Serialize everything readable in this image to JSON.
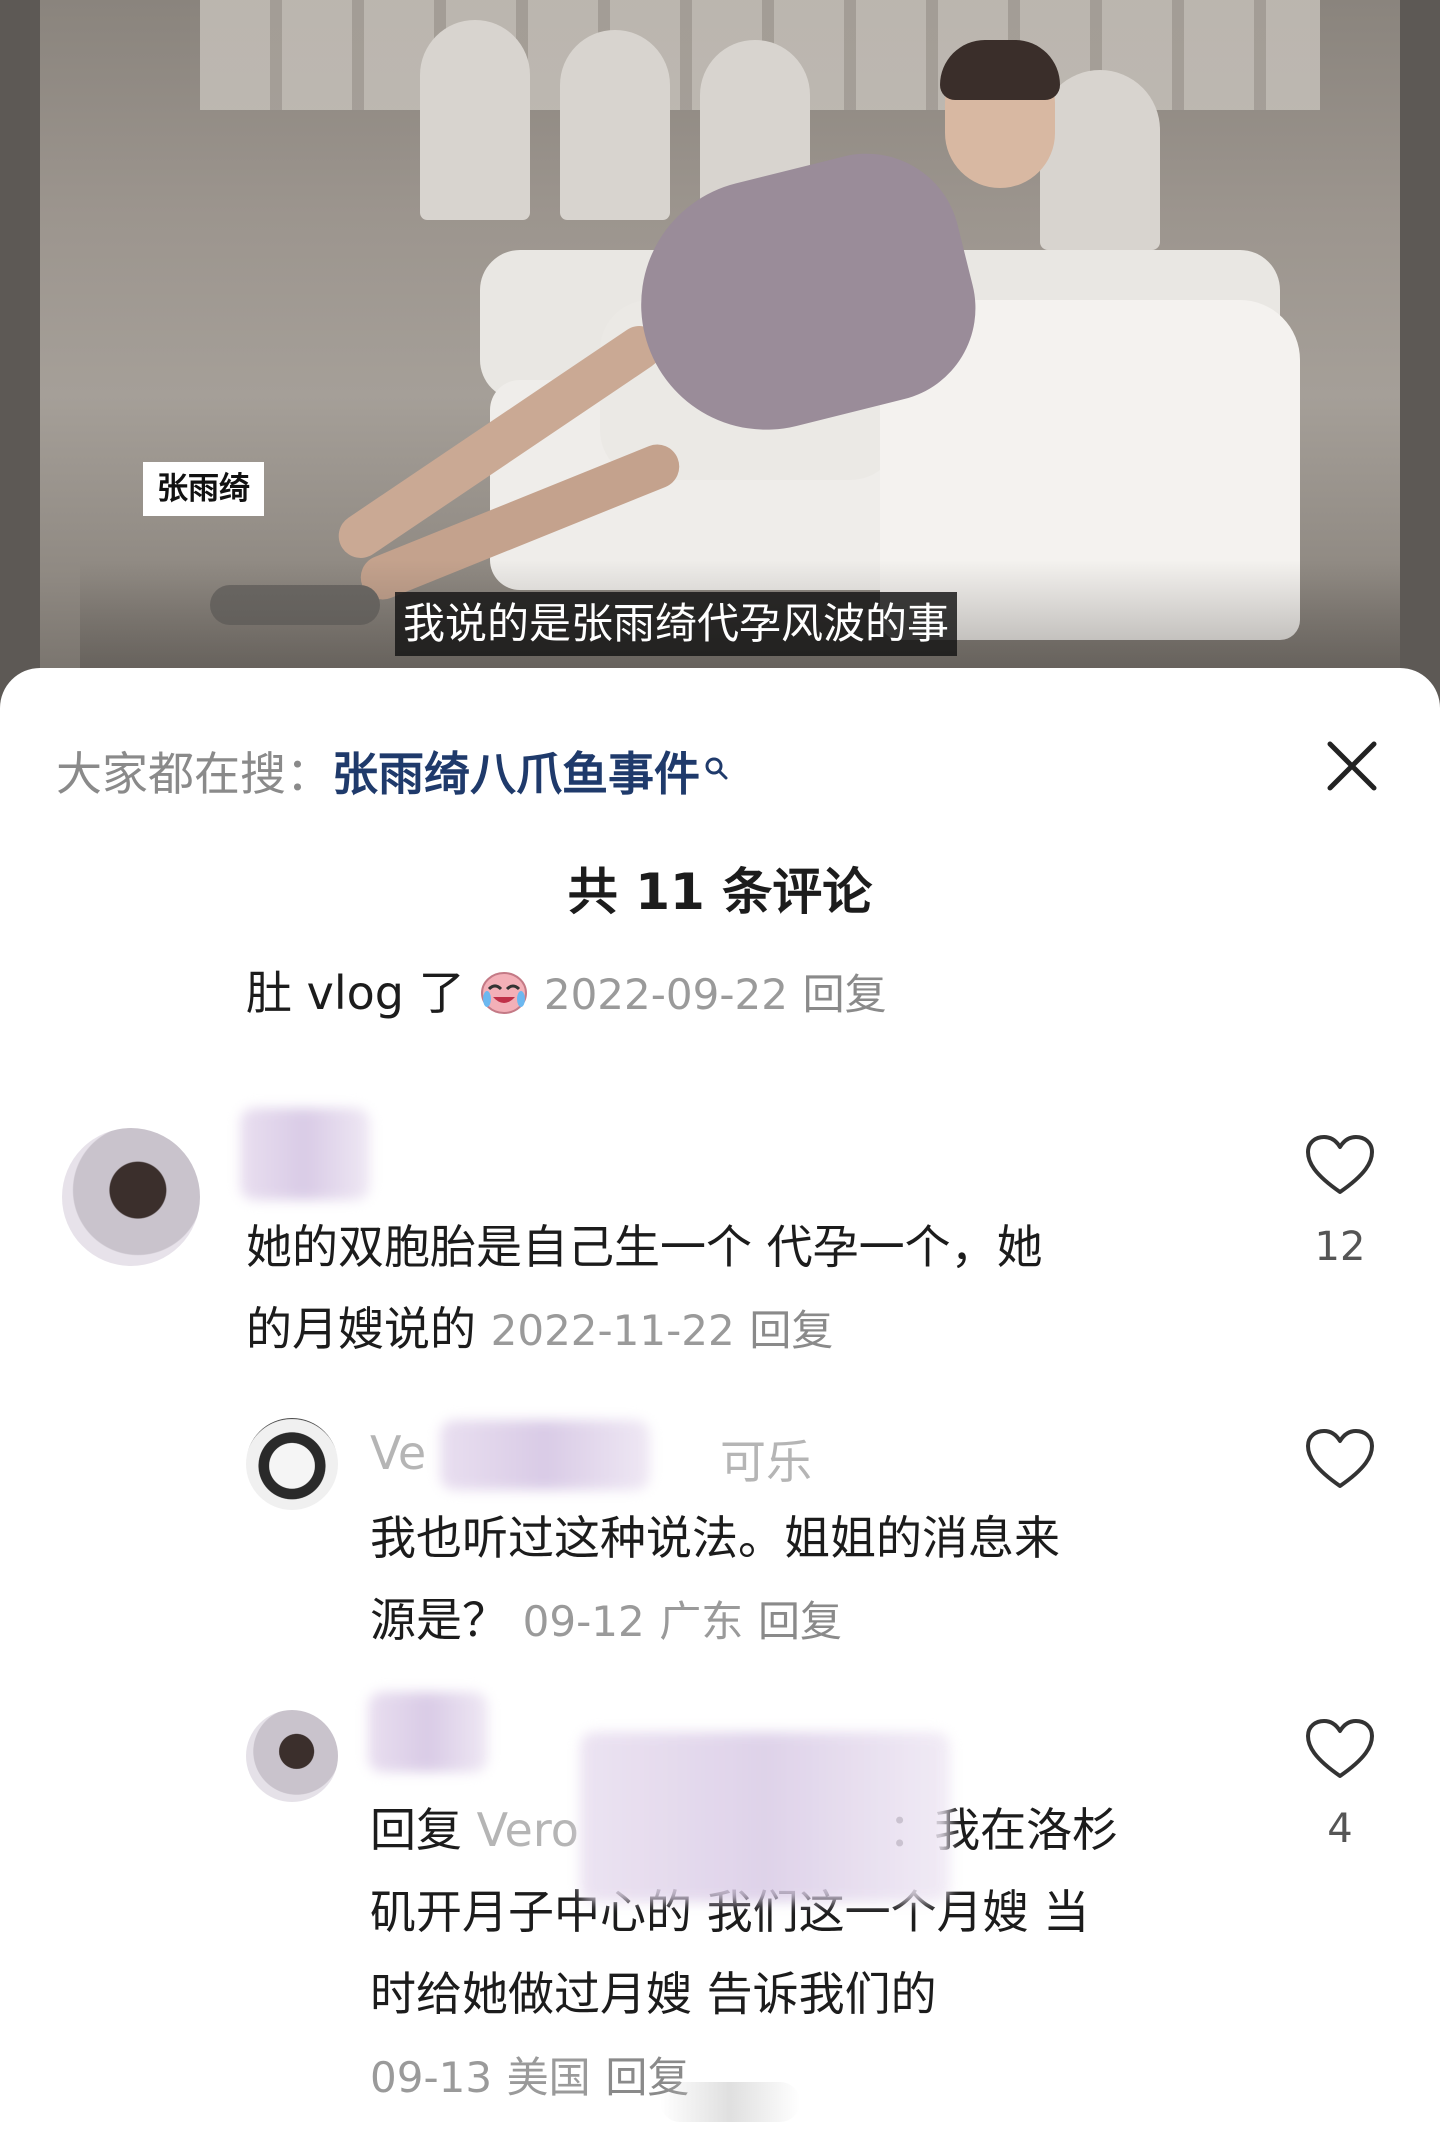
{
  "video": {
    "name_tag": "张雨绮",
    "subtitle": "我说的是张雨绮代孕风波的事"
  },
  "search": {
    "prefix": "大家都在搜：",
    "term": "张雨绮八爪鱼事件"
  },
  "comments_header": {
    "count_label": "共 11 条评论"
  },
  "top_fragment": {
    "text": "肚 vlog 了",
    "emoji": "crying-laugh-emoji",
    "date": "2022-09-22",
    "reply": "回复"
  },
  "comment1": {
    "line1": "她的双胞胎是自己生一个 代孕一个，她",
    "line2": "的月嫂说的",
    "date": "2022-11-22",
    "reply": "回复",
    "likes": "12"
  },
  "comment2": {
    "username_start": "Ve",
    "username_end": "可乐",
    "line1": "我也听过这种说法。姐姐的消息来",
    "line2": "源是？",
    "date": "09-12",
    "location": "广东",
    "reply": "回复"
  },
  "comment3": {
    "reply_prefix": "回复",
    "reply_to_start": "Vero",
    "line1_tail": "：我在洛杉",
    "line2": "矶开月子中心的 我们这一个月嫂 当",
    "line3": "时给她做过月嫂 告诉我们的",
    "date": "09-13",
    "location": "美国",
    "reply": "回复",
    "likes": "4"
  },
  "colors": {
    "link_blue": "#1f3a6b",
    "meta_gray": "#9a9a9a",
    "text_dark": "#1c1c1c"
  }
}
